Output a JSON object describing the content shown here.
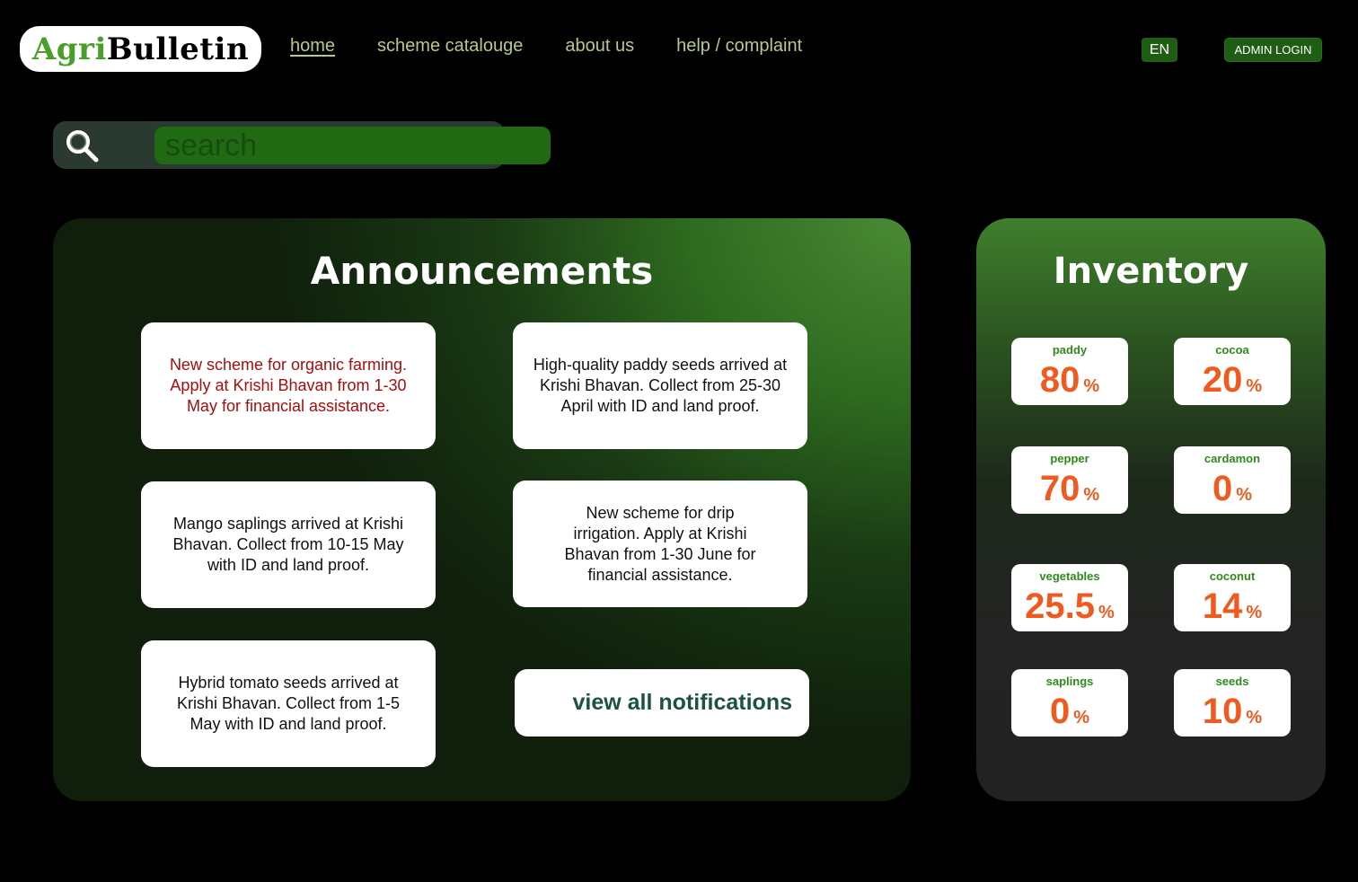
{
  "header": {
    "logo_part1": "Agri",
    "logo_part2": "Bulletin",
    "nav": [
      "home",
      "scheme catalouge",
      "about us",
      "help / complaint"
    ],
    "language": "EN",
    "admin_login": "ADMIN LOGIN"
  },
  "search": {
    "placeholder": "search"
  },
  "announcements": {
    "title": "Announcements",
    "items": [
      "New scheme for organic farming. Apply at Krishi Bhavan from 1-30 May for financial assistance.",
      "High-quality paddy seeds arrived at Krishi Bhavan. Collect from 25-30 April with ID and land proof.",
      "Mango saplings arrived at Krishi Bhavan. Collect from 10-15 May with ID and land proof.",
      "New scheme for drip irrigation. Apply at Krishi Bhavan from 1-30 June for financial assistance.",
      "Hybrid tomato seeds arrived at Krishi Bhavan. Collect from 1-5 May with ID and land proof."
    ],
    "view_all": "view all notifications"
  },
  "inventory": {
    "title": "Inventory",
    "unit": "%",
    "items": [
      {
        "name": "paddy",
        "value": "80"
      },
      {
        "name": "cocoa",
        "value": "20"
      },
      {
        "name": "pepper",
        "value": "70"
      },
      {
        "name": "cardamon",
        "value": "0"
      },
      {
        "name": "vegetables",
        "value": "25.5"
      },
      {
        "name": "coconut",
        "value": "14"
      },
      {
        "name": "saplings",
        "value": "0"
      },
      {
        "name": "seeds",
        "value": "10"
      }
    ]
  },
  "colors": {
    "accent_green": "#1f5d14",
    "alert_red": "#a50e0e",
    "inventory_value": "#f05a1f",
    "nav_text": "#b7c98a"
  }
}
